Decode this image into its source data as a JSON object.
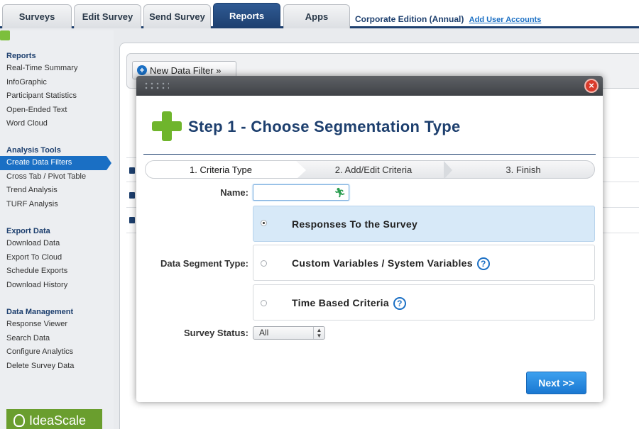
{
  "tabs": [
    "Surveys",
    "Edit Survey",
    "Send Survey",
    "Reports",
    "Apps"
  ],
  "active_tab": "Reports",
  "edition": "Corporate Edition (Annual)",
  "add_user_link": "Add User Accounts",
  "sidebar": {
    "groups": [
      {
        "title": "Reports",
        "items": [
          "Real-Time Summary",
          "InfoGraphic",
          "Participant Statistics",
          "Open-Ended Text",
          "Word Cloud"
        ]
      },
      {
        "title": "Analysis Tools",
        "items": [
          "Create Data Filters",
          "Cross Tab / Pivot Table",
          "Trend Analysis",
          "TURF Analysis"
        ]
      },
      {
        "title": "Export Data",
        "items": [
          "Download Data",
          "Export To Cloud",
          "Schedule Exports",
          "Download History"
        ]
      },
      {
        "title": "Data Management",
        "items": [
          "Response Viewer",
          "Search Data",
          "Configure Analytics",
          "Delete Survey Data"
        ]
      }
    ],
    "active_item": "Create Data Filters",
    "logo_text": "IdeaScale"
  },
  "new_filter_button": "New Data Filter »",
  "modal": {
    "title": "Step 1 - Choose Segmentation Type",
    "wizard_steps": [
      "1. Criteria Type",
      "2. Add/Edit Criteria",
      "3. Finish"
    ],
    "name_label": "Name:",
    "name_value": "",
    "segment_type_label": "Data Segment Type:",
    "segment_options": [
      {
        "label": "Responses To the Survey",
        "selected": true,
        "help": false
      },
      {
        "label": "Custom Variables / System Variables",
        "selected": false,
        "help": true
      },
      {
        "label": "Time Based Criteria",
        "selected": false,
        "help": true
      }
    ],
    "help_glyph": "?",
    "close_glyph": "×",
    "survey_status_label": "Survey Status:",
    "survey_status_value": "All",
    "next_button": "Next >>"
  },
  "colors": {
    "brand_navy": "#1d3f6e",
    "link_blue": "#1a6fc4",
    "green_plus": "#6fb52c",
    "selected_option": "#d7e9f8"
  }
}
